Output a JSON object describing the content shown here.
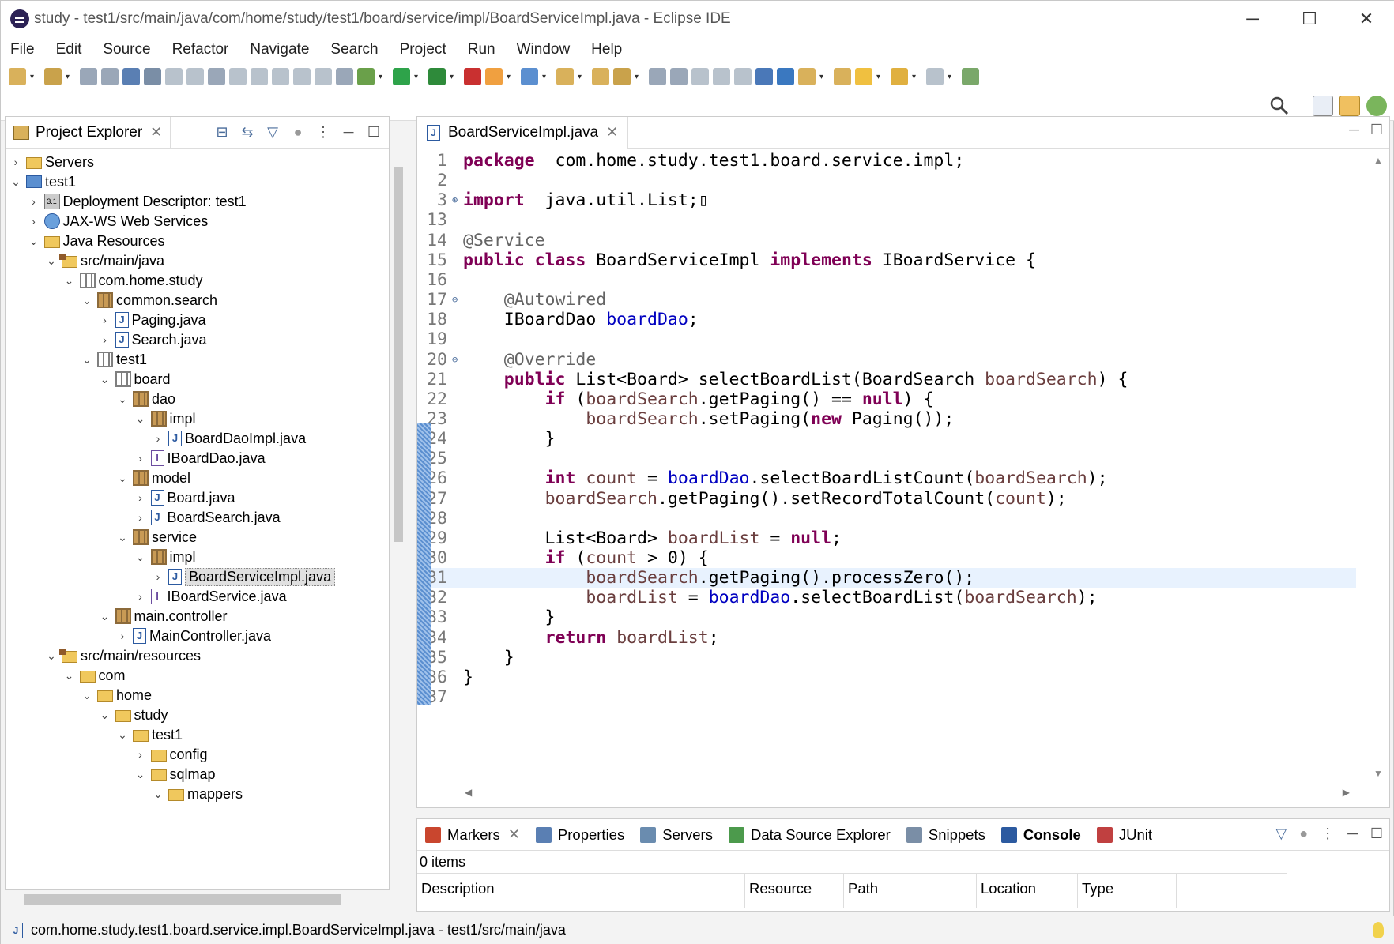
{
  "window": {
    "title": "study - test1/src/main/java/com/home/study/test1/board/service/impl/BoardServiceImpl.java - Eclipse IDE",
    "minimize": "─",
    "maximize": "☐",
    "close": "✕"
  },
  "menu": [
    "File",
    "Edit",
    "Source",
    "Refactor",
    "Navigate",
    "Search",
    "Project",
    "Run",
    "Window",
    "Help"
  ],
  "project_explorer": {
    "title": "Project Explorer",
    "tree": [
      {
        "label": "Servers",
        "depth": 0,
        "twisty": "›",
        "icon": "folder-icon"
      },
      {
        "label": "test1",
        "depth": 0,
        "twisty": "⌄",
        "icon": "project-icon"
      },
      {
        "label": "Deployment Descriptor: test1",
        "depth": 1,
        "twisty": "›",
        "icon": "deployment-descriptor-icon"
      },
      {
        "label": "JAX-WS Web Services",
        "depth": 1,
        "twisty": "›",
        "icon": "web-services-icon"
      },
      {
        "label": "Java Resources",
        "depth": 1,
        "twisty": "⌄",
        "icon": "java-resources-icon"
      },
      {
        "label": "src/main/java",
        "depth": 2,
        "twisty": "⌄",
        "icon": "source-folder-icon"
      },
      {
        "label": "com.home.study",
        "depth": 3,
        "twisty": "⌄",
        "icon": "empty-package-icon"
      },
      {
        "label": "common.search",
        "depth": 4,
        "twisty": "⌄",
        "icon": "package-icon"
      },
      {
        "label": "Paging.java",
        "depth": 5,
        "twisty": "›",
        "icon": "java-file-icon"
      },
      {
        "label": "Search.java",
        "depth": 5,
        "twisty": "›",
        "icon": "java-file-icon"
      },
      {
        "label": "test1",
        "depth": 4,
        "twisty": "⌄",
        "icon": "empty-package-icon"
      },
      {
        "label": "board",
        "depth": 5,
        "twisty": "⌄",
        "icon": "empty-package-icon"
      },
      {
        "label": "dao",
        "depth": 6,
        "twisty": "⌄",
        "icon": "package-icon"
      },
      {
        "label": "impl",
        "depth": 7,
        "twisty": "⌄",
        "icon": "package-icon"
      },
      {
        "label": "BoardDaoImpl.java",
        "depth": 8,
        "twisty": "›",
        "icon": "java-file-icon"
      },
      {
        "label": "IBoardDao.java",
        "depth": 7,
        "twisty": "›",
        "icon": "interface-file-icon"
      },
      {
        "label": "model",
        "depth": 6,
        "twisty": "⌄",
        "icon": "package-icon"
      },
      {
        "label": "Board.java",
        "depth": 7,
        "twisty": "›",
        "icon": "java-file-icon"
      },
      {
        "label": "BoardSearch.java",
        "depth": 7,
        "twisty": "›",
        "icon": "java-file-icon"
      },
      {
        "label": "service",
        "depth": 6,
        "twisty": "⌄",
        "icon": "package-icon"
      },
      {
        "label": "impl",
        "depth": 7,
        "twisty": "⌄",
        "icon": "package-icon"
      },
      {
        "label": "BoardServiceImpl.java",
        "depth": 8,
        "twisty": "›",
        "icon": "java-file-icon",
        "selected": true
      },
      {
        "label": "IBoardService.java",
        "depth": 7,
        "twisty": "›",
        "icon": "interface-file-icon"
      },
      {
        "label": "main.controller",
        "depth": 5,
        "twisty": "⌄",
        "icon": "package-icon"
      },
      {
        "label": "MainController.java",
        "depth": 6,
        "twisty": "›",
        "icon": "java-file-icon"
      },
      {
        "label": "src/main/resources",
        "depth": 2,
        "twisty": "⌄",
        "icon": "source-folder-icon"
      },
      {
        "label": "com",
        "depth": 3,
        "twisty": "⌄",
        "icon": "folder-icon"
      },
      {
        "label": "home",
        "depth": 4,
        "twisty": "⌄",
        "icon": "folder-icon"
      },
      {
        "label": "study",
        "depth": 5,
        "twisty": "⌄",
        "icon": "folder-icon"
      },
      {
        "label": "test1",
        "depth": 6,
        "twisty": "⌄",
        "icon": "folder-icon"
      },
      {
        "label": "config",
        "depth": 7,
        "twisty": "›",
        "icon": "folder-icon"
      },
      {
        "label": "sqlmap",
        "depth": 7,
        "twisty": "⌄",
        "icon": "folder-icon"
      },
      {
        "label": "mappers",
        "depth": 8,
        "twisty": "⌄",
        "icon": "folder-icon"
      }
    ]
  },
  "editor": {
    "tab_label": "BoardServiceImpl.java",
    "current_line": 31,
    "lines": [
      {
        "n": "1",
        "t": [
          [
            "kw",
            "package"
          ],
          [
            "",
            "  com.home.study.test1.board.service.impl;"
          ]
        ]
      },
      {
        "n": "2",
        "t": []
      },
      {
        "n": "3",
        "fold": "⊕",
        "t": [
          [
            "kw",
            "import"
          ],
          [
            "",
            "  java.util.List;"
          ],
          [
            "",
            "▯"
          ]
        ]
      },
      {
        "n": "13",
        "t": []
      },
      {
        "n": "14",
        "t": [
          [
            "an",
            "@Service"
          ]
        ]
      },
      {
        "n": "15",
        "t": [
          [
            "kw",
            "public"
          ],
          [
            "",
            " "
          ],
          [
            "kw",
            "class"
          ],
          [
            "",
            " BoardServiceImpl "
          ],
          [
            "kw",
            "implements"
          ],
          [
            "",
            " IBoardService {"
          ]
        ]
      },
      {
        "n": "16",
        "t": []
      },
      {
        "n": "17",
        "fold": "⊖",
        "t": [
          [
            "",
            "    "
          ],
          [
            "an",
            "@Autowired"
          ]
        ]
      },
      {
        "n": "18",
        "t": [
          [
            "",
            "    IBoardDao "
          ],
          [
            "fd",
            "boardDao"
          ],
          [
            "",
            ";"
          ]
        ]
      },
      {
        "n": "19",
        "t": []
      },
      {
        "n": "20",
        "fold": "⊖",
        "t": [
          [
            "",
            "    "
          ],
          [
            "an",
            "@Override"
          ]
        ]
      },
      {
        "n": "21",
        "t": [
          [
            "",
            "    "
          ],
          [
            "kw",
            "public"
          ],
          [
            "",
            " List<Board> selectBoardList(BoardSearch "
          ],
          [
            "lv",
            "boardSearch"
          ],
          [
            "",
            ") {"
          ]
        ]
      },
      {
        "n": "22",
        "t": [
          [
            "",
            "        "
          ],
          [
            "kw",
            "if"
          ],
          [
            "",
            " ("
          ],
          [
            "lv",
            "boardSearch"
          ],
          [
            "",
            ".getPaging() == "
          ],
          [
            "kw",
            "null"
          ],
          [
            "",
            ") {"
          ]
        ]
      },
      {
        "n": "23",
        "t": [
          [
            "",
            "            "
          ],
          [
            "lv",
            "boardSearch"
          ],
          [
            "",
            ".setPaging("
          ],
          [
            "kw",
            "new"
          ],
          [
            "",
            " Paging());"
          ]
        ]
      },
      {
        "n": "24",
        "t": [
          [
            "",
            "        }"
          ]
        ]
      },
      {
        "n": "25",
        "t": []
      },
      {
        "n": "26",
        "t": [
          [
            "",
            "        "
          ],
          [
            "kw",
            "int"
          ],
          [
            "",
            " "
          ],
          [
            "lv",
            "count"
          ],
          [
            "",
            " = "
          ],
          [
            "fd",
            "boardDao"
          ],
          [
            "",
            ".selectBoardListCount("
          ],
          [
            "lv",
            "boardSearch"
          ],
          [
            "",
            ");"
          ]
        ]
      },
      {
        "n": "27",
        "t": [
          [
            "",
            "        "
          ],
          [
            "lv",
            "boardSearch"
          ],
          [
            "",
            ".getPaging().setRecordTotalCount("
          ],
          [
            "lv",
            "count"
          ],
          [
            "",
            ");"
          ]
        ]
      },
      {
        "n": "28",
        "t": []
      },
      {
        "n": "29",
        "t": [
          [
            "",
            "        List<Board> "
          ],
          [
            "lv",
            "boardList"
          ],
          [
            "",
            " = "
          ],
          [
            "kw",
            "null"
          ],
          [
            "",
            ";"
          ]
        ]
      },
      {
        "n": "30",
        "t": [
          [
            "",
            "        "
          ],
          [
            "kw",
            "if"
          ],
          [
            "",
            " ("
          ],
          [
            "lv",
            "count"
          ],
          [
            "",
            " > 0) {"
          ]
        ]
      },
      {
        "n": "31",
        "t": [
          [
            "",
            "            "
          ],
          [
            "lv",
            "boardSearch"
          ],
          [
            "",
            ".getPaging().processZero();"
          ]
        ]
      },
      {
        "n": "32",
        "t": [
          [
            "",
            "            "
          ],
          [
            "lv",
            "boardList"
          ],
          [
            "",
            " = "
          ],
          [
            "fd",
            "boardDao"
          ],
          [
            "",
            ".selectBoardList("
          ],
          [
            "lv",
            "boardSearch"
          ],
          [
            "",
            ");"
          ]
        ]
      },
      {
        "n": "33",
        "t": [
          [
            "",
            "        }"
          ]
        ]
      },
      {
        "n": "34",
        "t": [
          [
            "",
            "        "
          ],
          [
            "kw",
            "return"
          ],
          [
            "",
            " "
          ],
          [
            "lv",
            "boardList"
          ],
          [
            "",
            ";"
          ]
        ]
      },
      {
        "n": "35",
        "t": [
          [
            "",
            "    }"
          ]
        ]
      },
      {
        "n": "36",
        "t": [
          [
            "",
            "}"
          ]
        ]
      },
      {
        "n": "37",
        "t": []
      }
    ]
  },
  "bottom_panel": {
    "tabs": [
      {
        "label": "Markers",
        "icon": "markers-icon",
        "color": "#c9462e"
      },
      {
        "label": "Properties",
        "icon": "properties-icon",
        "color": "#5a7fb3"
      },
      {
        "label": "Servers",
        "icon": "servers-icon",
        "color": "#6a8caf"
      },
      {
        "label": "Data Source Explorer",
        "icon": "data-source-icon",
        "color": "#4c9a4c"
      },
      {
        "label": "Snippets",
        "icon": "snippets-icon",
        "color": "#7a8ea6"
      },
      {
        "label": "Console",
        "icon": "console-icon",
        "color": "#2c5aa0",
        "active": true
      },
      {
        "label": "JUnit",
        "icon": "junit-icon",
        "color": "#c04040"
      }
    ],
    "items_count": "0 items",
    "columns": [
      "Description",
      "Resource",
      "Path",
      "Location",
      "Type"
    ]
  },
  "status": {
    "text": "com.home.study.test1.board.service.impl.BoardServiceImpl.java - test1/src/main/java"
  }
}
